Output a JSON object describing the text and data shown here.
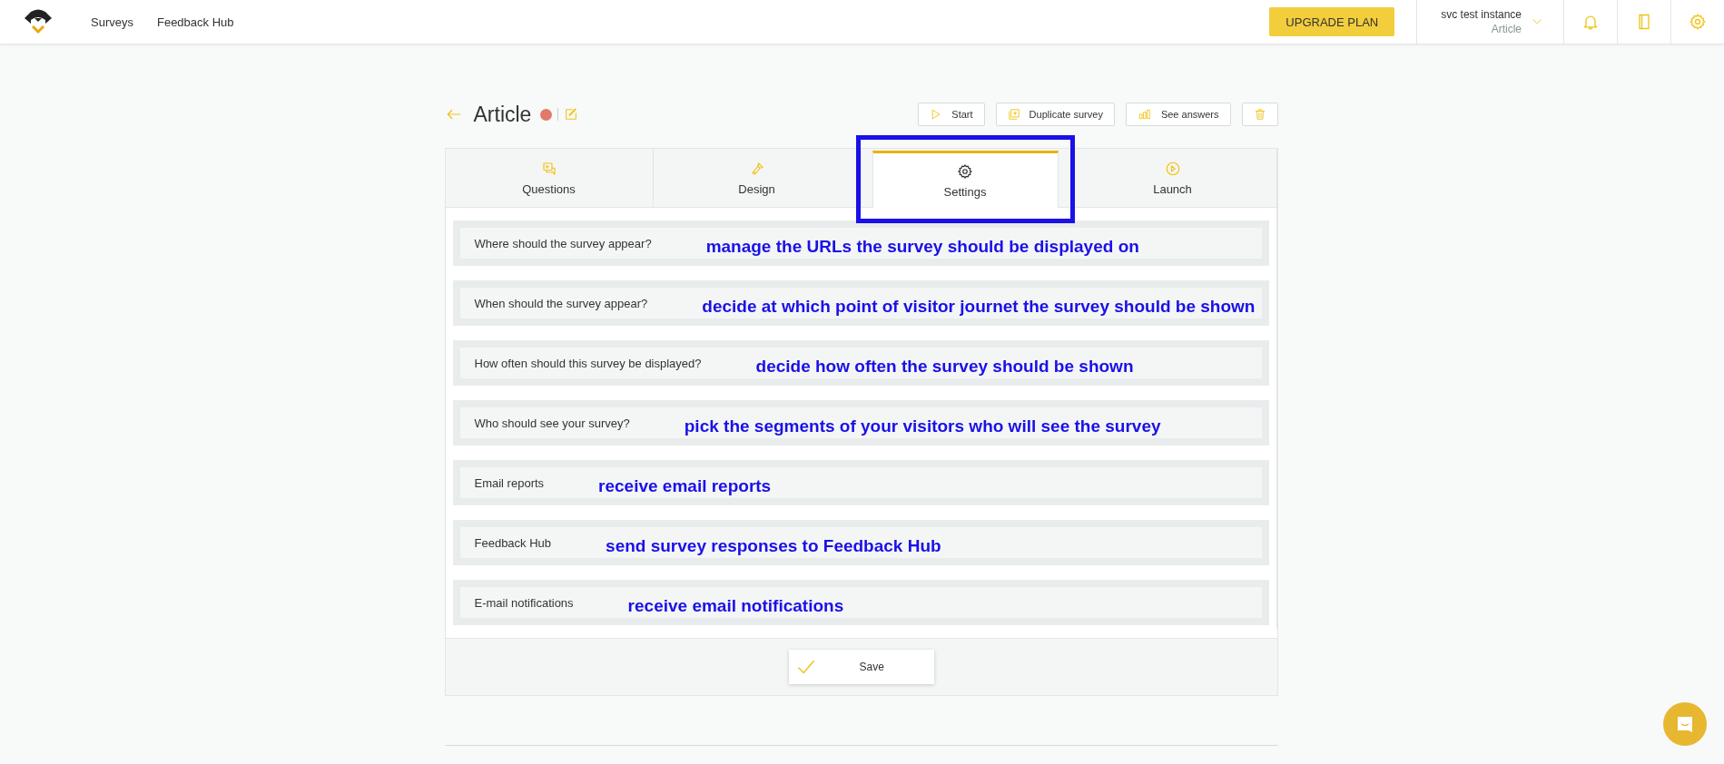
{
  "topbar": {
    "nav": [
      "Surveys",
      "Feedback Hub"
    ],
    "upgrade": "UPGRADE PLAN",
    "account": {
      "name": "svc test instance",
      "survey": "Article"
    }
  },
  "header": {
    "title": "Article",
    "status": {
      "color": "#e07a6a"
    },
    "actions": [
      {
        "kind": "start",
        "label": "Start"
      },
      {
        "kind": "duplicate",
        "label": "Duplicate survey"
      },
      {
        "kind": "answers",
        "label": "See answers"
      },
      {
        "kind": "delete"
      }
    ]
  },
  "tabs": [
    {
      "kind": "questions",
      "label": "Questions",
      "selected": false,
      "highlighted": false
    },
    {
      "kind": "design",
      "label": "Design",
      "selected": false,
      "highlighted": false
    },
    {
      "kind": "settings",
      "label": "Settings",
      "selected": true,
      "highlighted": true
    },
    {
      "kind": "launch",
      "label": "Launch",
      "selected": false,
      "highlighted": false
    }
  ],
  "settings": [
    {
      "label": "Where should the survey appear?",
      "annotation": "manage the URLs the survey should be displayed on"
    },
    {
      "label": "When should the survey appear?",
      "annotation": "decide at which point of visitor journet the survey should be shown"
    },
    {
      "label": "How often should this survey be displayed?",
      "annotation": "decide how often the survey should be shown"
    },
    {
      "label": "Who should see your survey?",
      "annotation": "pick the segments of your visitors who will see the survey"
    },
    {
      "label": "Email reports",
      "annotation": "receive email reports"
    },
    {
      "label": "Feedback Hub",
      "annotation": "send survey responses to Feedback Hub"
    },
    {
      "label": "E-mail notifications",
      "annotation": "receive email notifications"
    }
  ],
  "save": "Save"
}
